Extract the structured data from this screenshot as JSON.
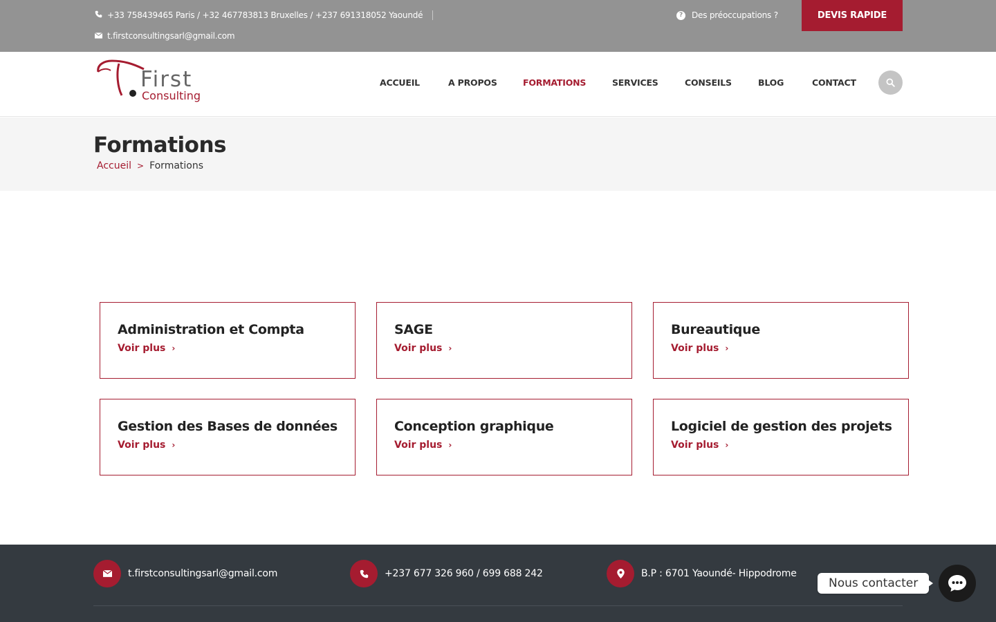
{
  "topbar": {
    "phones": "+33 758439465 Paris / +32 467783813 Bruxelles / +237 691318052 Yaoundé",
    "email": "t.firstconsultingsarl@gmail.com",
    "help_text": "Des préoccupations ?",
    "devis_label": "DEVIS RAPIDE"
  },
  "logo": {
    "line1": "First",
    "line2": "Consulting"
  },
  "nav": {
    "items": [
      {
        "label": "ACCUEIL"
      },
      {
        "label": "A PROPOS"
      },
      {
        "label": "FORMATIONS"
      },
      {
        "label": "SERVICES"
      },
      {
        "label": "CONSEILS"
      },
      {
        "label": "BLOG"
      },
      {
        "label": "CONTACT"
      }
    ],
    "active": "FORMATIONS"
  },
  "page": {
    "title": "Formations",
    "breadcrumb_home": "Accueil",
    "breadcrumb_sep": ">",
    "breadcrumb_current": "Formations"
  },
  "cards": [
    {
      "title": "Administration et Compta",
      "link": "Voir plus"
    },
    {
      "title": "SAGE",
      "link": "Voir plus"
    },
    {
      "title": "Bureautique",
      "link": "Voir plus"
    },
    {
      "title": "Gestion des Bases de données",
      "link": "Voir plus"
    },
    {
      "title": "Conception graphique",
      "link": "Voir plus"
    },
    {
      "title": "Logiciel de gestion des projets",
      "link": "Voir plus"
    }
  ],
  "footer": {
    "email": "t.firstconsultingsarl@gmail.com",
    "phone": "+237 677 326 960 / 699 688 242",
    "address": "B.P : 6701 Yaoundé- Hippodrome"
  },
  "chat": {
    "label": "Nous contacter"
  },
  "colors": {
    "brand": "#a51c30",
    "topbar": "#939393",
    "footer": "#343a40"
  }
}
